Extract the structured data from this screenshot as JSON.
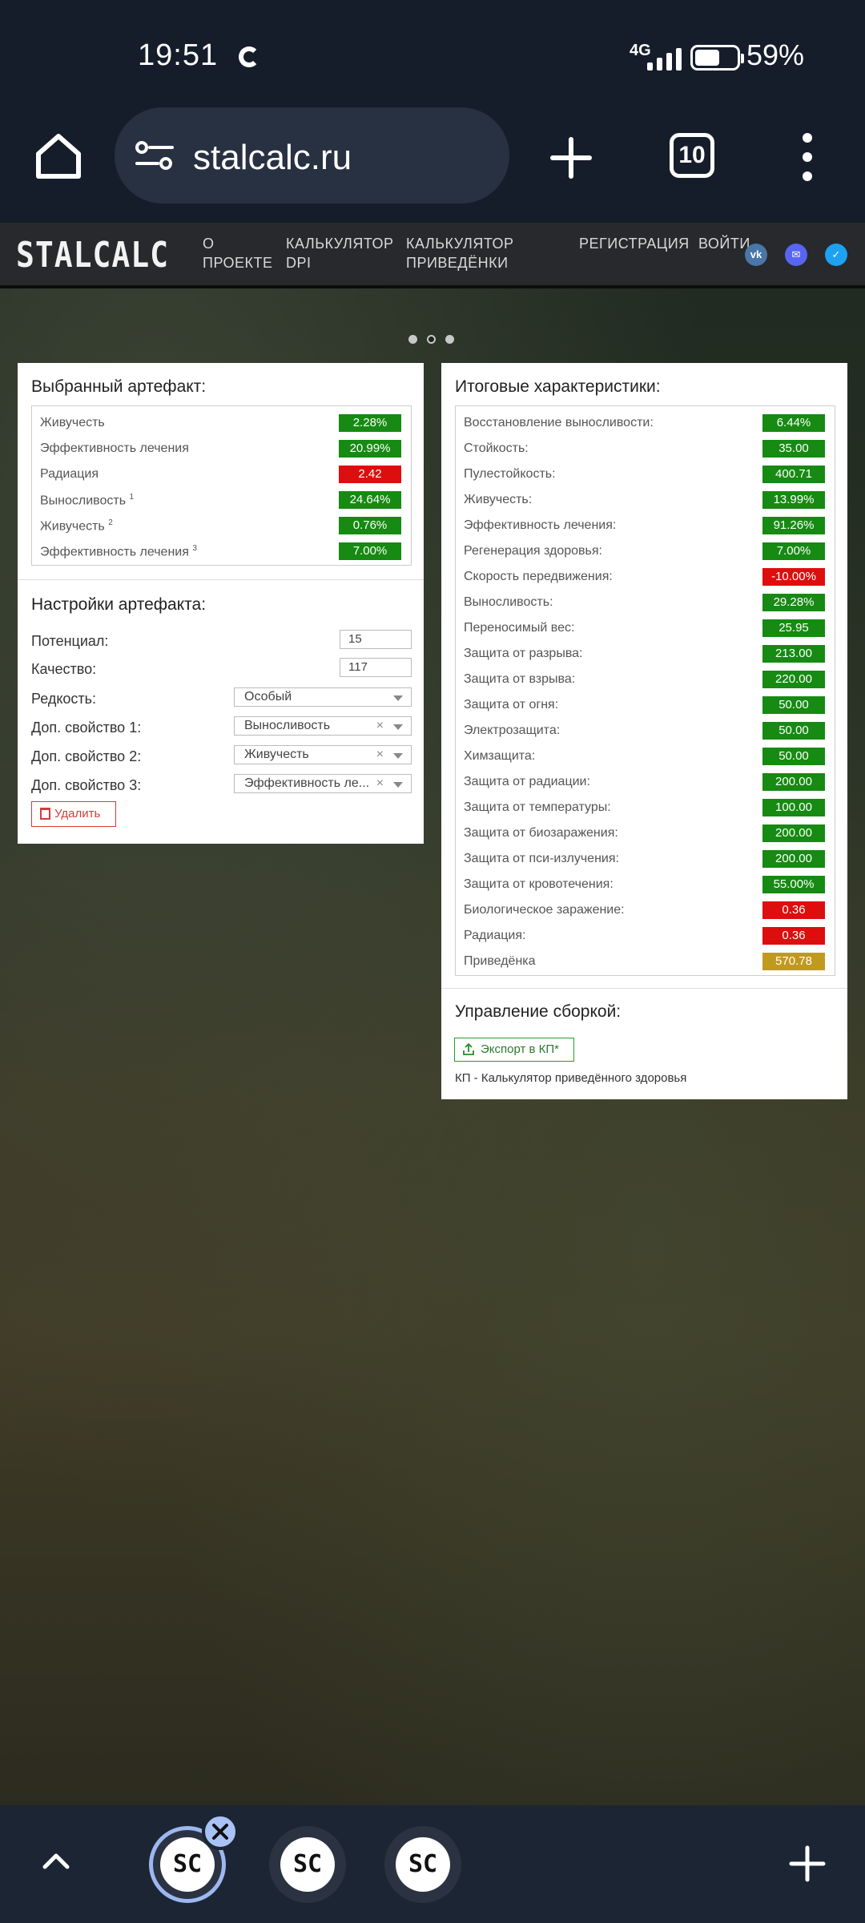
{
  "status_bar": {
    "time": "19:51",
    "network": "4G",
    "battery_percent": "59%",
    "battery_level": 0.59
  },
  "browser": {
    "url": "stalcalc.ru",
    "tab_count": "10"
  },
  "site": {
    "logo": "STALCALC",
    "nav": {
      "about_line1": "О",
      "about_line2": "ПРОЕКТЕ",
      "dpi_line1": "КАЛЬКУЛЯТОР",
      "dpi_line2": "DPI",
      "reduced_line1": "КАЛЬКУЛЯТОР",
      "reduced_line2": "ПРИВЕДЁНКИ",
      "register": "РЕГИСТРАЦИЯ",
      "login": "ВОЙТИ"
    },
    "social": {
      "vk": "vk",
      "discord": "✉",
      "twitter": "✓"
    }
  },
  "artifact_panel": {
    "title": "Выбранный артефакт:",
    "rows": [
      {
        "label": "Живучесть",
        "sup": "",
        "value": "2.28%",
        "color": "green"
      },
      {
        "label": "Эффективность лечения",
        "sup": "",
        "value": "20.99%",
        "color": "green"
      },
      {
        "label": "Радиация",
        "sup": "",
        "value": "2.42",
        "color": "red"
      },
      {
        "label": "Выносливость",
        "sup": "1",
        "value": "24.64%",
        "color": "green"
      },
      {
        "label": "Живучесть",
        "sup": "2",
        "value": "0.76%",
        "color": "green"
      },
      {
        "label": "Эффективность лечения",
        "sup": "3",
        "value": "7.00%",
        "color": "green"
      }
    ],
    "settings_title": "Настройки артефакта:",
    "potential_label": "Потенциал:",
    "potential_value": "15",
    "quality_label": "Качество:",
    "quality_value": "117",
    "rarity_label": "Редкость:",
    "rarity_value": "Особый",
    "extra1_label": "Доп. свойство 1:",
    "extra1_value": "Выносливость",
    "extra2_label": "Доп. свойство 2:",
    "extra2_value": "Живучесть",
    "extra3_label": "Доп. свойство 3:",
    "extra3_value": "Эффективность ле...",
    "delete_label": "Удалить"
  },
  "totals_panel": {
    "title": "Итоговые характеристики:",
    "rows": [
      {
        "label": "Восстановление выносливости:",
        "value": "6.44%",
        "color": "green"
      },
      {
        "label": "Стойкость:",
        "value": "35.00",
        "color": "green"
      },
      {
        "label": "Пулестойкость:",
        "value": "400.71",
        "color": "green"
      },
      {
        "label": "Живучесть:",
        "value": "13.99%",
        "color": "green"
      },
      {
        "label": "Эффективность лечения:",
        "value": "91.26%",
        "color": "green"
      },
      {
        "label": "Регенерация здоровья:",
        "value": "7.00%",
        "color": "green"
      },
      {
        "label": "Скорость передвижения:",
        "value": "-10.00%",
        "color": "red"
      },
      {
        "label": "Выносливость:",
        "value": "29.28%",
        "color": "green"
      },
      {
        "label": "Переносимый вес:",
        "value": "25.95",
        "color": "green"
      },
      {
        "label": "Защита от разрыва:",
        "value": "213.00",
        "color": "green"
      },
      {
        "label": "Защита от взрыва:",
        "value": "220.00",
        "color": "green"
      },
      {
        "label": "Защита от огня:",
        "value": "50.00",
        "color": "green"
      },
      {
        "label": "Электрозащита:",
        "value": "50.00",
        "color": "green"
      },
      {
        "label": "Химзащита:",
        "value": "50.00",
        "color": "green"
      },
      {
        "label": "Защита от радиации:",
        "value": "200.00",
        "color": "green"
      },
      {
        "label": "Защита от температуры:",
        "value": "100.00",
        "color": "green"
      },
      {
        "label": "Защита от биозаражения:",
        "value": "200.00",
        "color": "green"
      },
      {
        "label": "Защита от пси-излучения:",
        "value": "200.00",
        "color": "green"
      },
      {
        "label": "Защита от кровотечения:",
        "value": "55.00%",
        "color": "green"
      },
      {
        "label": "Биологическое заражение:",
        "value": "0.36",
        "color": "red"
      },
      {
        "label": "Радиация:",
        "value": "0.36",
        "color": "red"
      },
      {
        "label": "Приведёнка",
        "value": "570.78",
        "color": "gold"
      }
    ],
    "build_title": "Управление сборкой:",
    "export_label": "Экспорт в КП*",
    "footnote": "КП - Калькулятор приведённого здоровья"
  },
  "tab_strip": {
    "tabs": [
      "SC",
      "SC",
      "SC"
    ]
  }
}
